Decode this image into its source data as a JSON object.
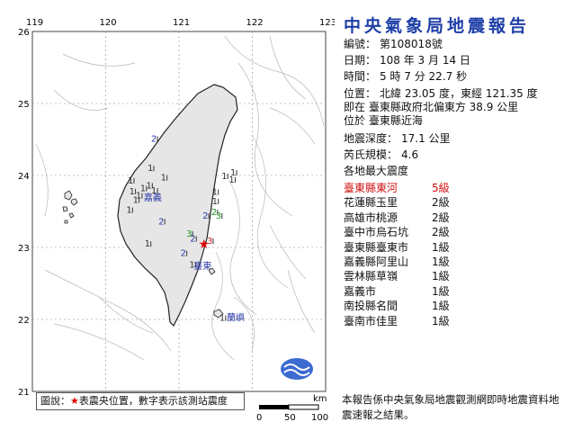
{
  "title": "中央氣象局地震報告",
  "report": {
    "number_label": "編號：",
    "number_value": "第108018號",
    "date_label": "日期：",
    "date_value": "108 年 3 月 14 日",
    "time_label": "時間：",
    "time_value": "5 時 7 分 22.7 秒",
    "location_label": "位置：",
    "location_value": "北緯 23.05 度，東經 121.35 度",
    "location_line2": "即在 臺東縣政府北偏東方 38.9 公里",
    "location_line3": "位於 臺東縣近海",
    "depth_label": "地震深度：",
    "depth_value": "17.1 公里",
    "magnitude_label": "芮氏規模：",
    "magnitude_value": "4.6",
    "intensity_header": "各地最大震度"
  },
  "intensities": [
    {
      "station": "臺東縣東河",
      "level": "5級",
      "highlight": true
    },
    {
      "station": "花蓮縣玉里",
      "level": "2級"
    },
    {
      "station": "高雄市桃源",
      "level": "2級"
    },
    {
      "station": "臺中市烏石坑",
      "level": "2級"
    },
    {
      "station": "臺東縣臺東市",
      "level": "1級"
    },
    {
      "station": "嘉義縣阿里山",
      "level": "1級"
    },
    {
      "station": "雲林縣草嶺",
      "level": "1級"
    },
    {
      "station": "嘉義市",
      "level": "1級"
    },
    {
      "station": "南投縣名間",
      "level": "1級"
    },
    {
      "station": "臺南市佳里",
      "level": "1級"
    }
  ],
  "footnote": "本報告係中央氣象局地震觀測網即時地震資料地震速報之結果。",
  "legend": {
    "prefix": "圖說：",
    "star": "★",
    "text": "表震央位置，數字表示該測站震度"
  },
  "map": {
    "lon_ticks": [
      "119",
      "120",
      "121",
      "122",
      "123"
    ],
    "lat_ticks": [
      "26",
      "25",
      "24",
      "23",
      "22",
      "21"
    ],
    "scale_unit": "km",
    "scale_ticks": [
      "0",
      "50",
      "100"
    ],
    "place_labels": [
      "嘉義",
      "臺東",
      "蘭嶼"
    ],
    "colors": {
      "epicenter": "#e00000",
      "level1": "#333333",
      "level2": "#2a3aa8",
      "level3": "#1f9a1f",
      "level5": "#cc2020"
    }
  },
  "map_points": [
    {
      "lon": 121.35,
      "lat": 23.05,
      "type": "epicenter"
    },
    {
      "lon": 120.62,
      "lat": 24.52,
      "label": "2",
      "level": 2
    },
    {
      "lon": 121.32,
      "lat": 23.45,
      "label": "2",
      "level": 2
    },
    {
      "lon": 120.72,
      "lat": 23.37,
      "label": "2",
      "level": 2
    },
    {
      "lon": 121.15,
      "lat": 23.13,
      "label": "2",
      "level": 2
    },
    {
      "lon": 121.02,
      "lat": 22.93,
      "label": "2",
      "level": 2
    },
    {
      "lon": 121.44,
      "lat": 23.5,
      "label": "2",
      "level": 3
    },
    {
      "lon": 121.1,
      "lat": 23.2,
      "label": "3",
      "level": 3
    },
    {
      "lon": 121.5,
      "lat": 23.45,
      "label": "3",
      "level": 3
    },
    {
      "lon": 121.38,
      "lat": 23.1,
      "label": "3",
      "level": 5
    },
    {
      "lon": 120.3,
      "lat": 23.94,
      "label": "1",
      "level": 1
    },
    {
      "lon": 120.57,
      "lat": 24.11,
      "label": "1",
      "level": 1
    },
    {
      "lon": 120.75,
      "lat": 23.98,
      "label": "1",
      "level": 1
    },
    {
      "lon": 121.58,
      "lat": 24.0,
      "label": "1",
      "level": 1
    },
    {
      "lon": 121.68,
      "lat": 23.95,
      "label": "1",
      "level": 1
    },
    {
      "lon": 121.7,
      "lat": 24.05,
      "label": "1",
      "level": 1
    },
    {
      "lon": 120.32,
      "lat": 23.79,
      "label": "1",
      "level": 1
    },
    {
      "lon": 120.41,
      "lat": 23.73,
      "label": "1",
      "level": 1
    },
    {
      "lon": 120.47,
      "lat": 23.83,
      "label": "1",
      "level": 1
    },
    {
      "lon": 120.55,
      "lat": 23.87,
      "label": "1",
      "level": 1
    },
    {
      "lon": 120.62,
      "lat": 23.8,
      "label": "1",
      "level": 1
    },
    {
      "lon": 120.28,
      "lat": 23.53,
      "label": "1",
      "level": 1
    },
    {
      "lon": 120.37,
      "lat": 23.67,
      "label": "1",
      "level": 1
    },
    {
      "lon": 121.45,
      "lat": 23.78,
      "label": "1",
      "level": 1
    },
    {
      "lon": 121.45,
      "lat": 23.65,
      "label": "1",
      "level": 1
    },
    {
      "lon": 120.53,
      "lat": 23.06,
      "label": "1",
      "level": 1
    },
    {
      "lon": 121.14,
      "lat": 22.77,
      "label": "1",
      "level": 1
    },
    {
      "lon": 121.55,
      "lat": 22.03,
      "label": "1",
      "level": 1
    },
    {
      "lon": 120.52,
      "lat": 23.7,
      "label": "",
      "place": "嘉義"
    },
    {
      "lon": 121.2,
      "lat": 22.75,
      "label": "",
      "place": "臺東"
    },
    {
      "lon": 121.65,
      "lat": 22.03,
      "label": "",
      "place": "蘭嶼"
    }
  ]
}
